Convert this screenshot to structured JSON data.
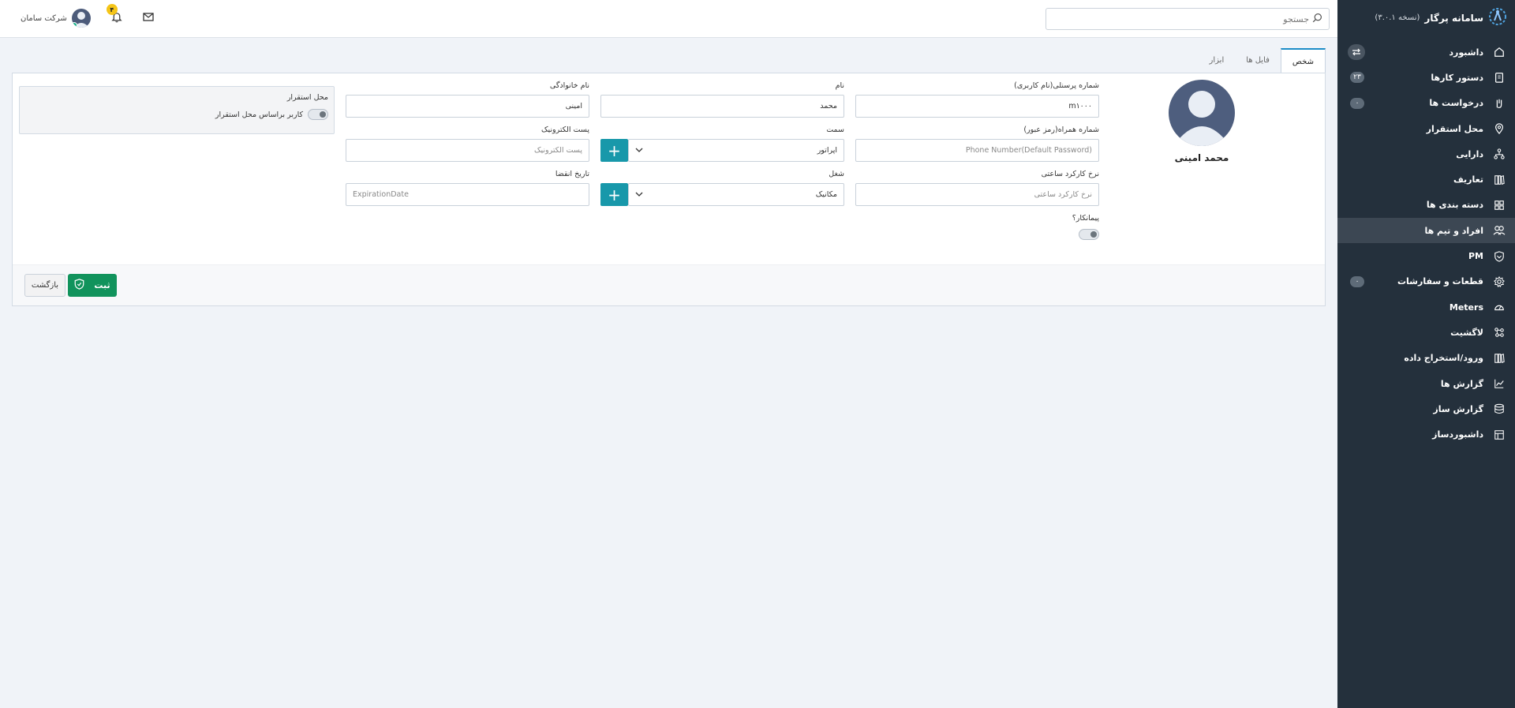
{
  "brand": {
    "title": "سامانه پرگار",
    "version": "(نسخه ۳.۰.۱)"
  },
  "sidebar": {
    "items": [
      {
        "label": "داشبورد",
        "icon": "home-icon"
      },
      {
        "label": "دستور کارها",
        "icon": "clipboard-icon",
        "badge": "۲۳"
      },
      {
        "label": "درخواست ها",
        "icon": "hand-icon",
        "badge": "۰"
      },
      {
        "label": "محل استقرار",
        "icon": "location-pin-icon"
      },
      {
        "label": "دارایی",
        "icon": "network-icon"
      },
      {
        "label": "تعاریف",
        "icon": "book-icon"
      },
      {
        "label": "دسته بندی ها",
        "icon": "grid-icon"
      },
      {
        "label": "افراد و تیم ها",
        "icon": "users-icon",
        "active": true
      },
      {
        "label": "PM",
        "icon": "shield-icon"
      },
      {
        "label": "قطعات و سفارشات",
        "icon": "gear-icon",
        "badge": "۰"
      },
      {
        "label": "Meters",
        "icon": "gauge-icon"
      },
      {
        "label": "لاگشیت",
        "icon": "nodes-icon"
      },
      {
        "label": "ورود/استخراج داده",
        "icon": "import-export-icon"
      },
      {
        "label": "گزارش ها",
        "icon": "chart-line-icon"
      },
      {
        "label": "گزارش ساز",
        "icon": "database-icon"
      },
      {
        "label": "داشبوردساز",
        "icon": "layout-icon"
      }
    ]
  },
  "topbar": {
    "search_placeholder": "جستجو",
    "user_name": "شرکت سامان",
    "notif_count": "۴"
  },
  "tabs": [
    "شخص",
    "فایل ها",
    "ابزار"
  ],
  "profile": {
    "name": "محمد امینی"
  },
  "form": {
    "personnel_label": "شماره پرسنلی(نام کاربری)",
    "personnel_value": "m۱۰۰۰",
    "first_name_label": "نام",
    "first_name_value": "محمد",
    "last_name_label": "نام خانوادگی",
    "last_name_value": "امینی",
    "phone_label": "شماره همراه(رمز عبور)",
    "phone_placeholder": "Phone Number(Default Password)",
    "position_label": "سمت",
    "position_value": "اپراتور",
    "email_label": "پست الکترونیک",
    "email_placeholder": "پست الکترونیک",
    "rate_label": "نرخ کارکرد ساعتی",
    "rate_placeholder": "نرخ کارکرد ساعتی",
    "job_label": "شغل",
    "job_value": "مکانیک",
    "expire_label": "تاریخ انقضا",
    "expire_placeholder": "ExpirationDate",
    "contractor_label": "پیمانکار؟",
    "location_title": "محل استقرار",
    "location_toggle_label": "کاربر براساس محل استقرار"
  },
  "buttons": {
    "save": "ثبت",
    "back": "بازگشت"
  }
}
